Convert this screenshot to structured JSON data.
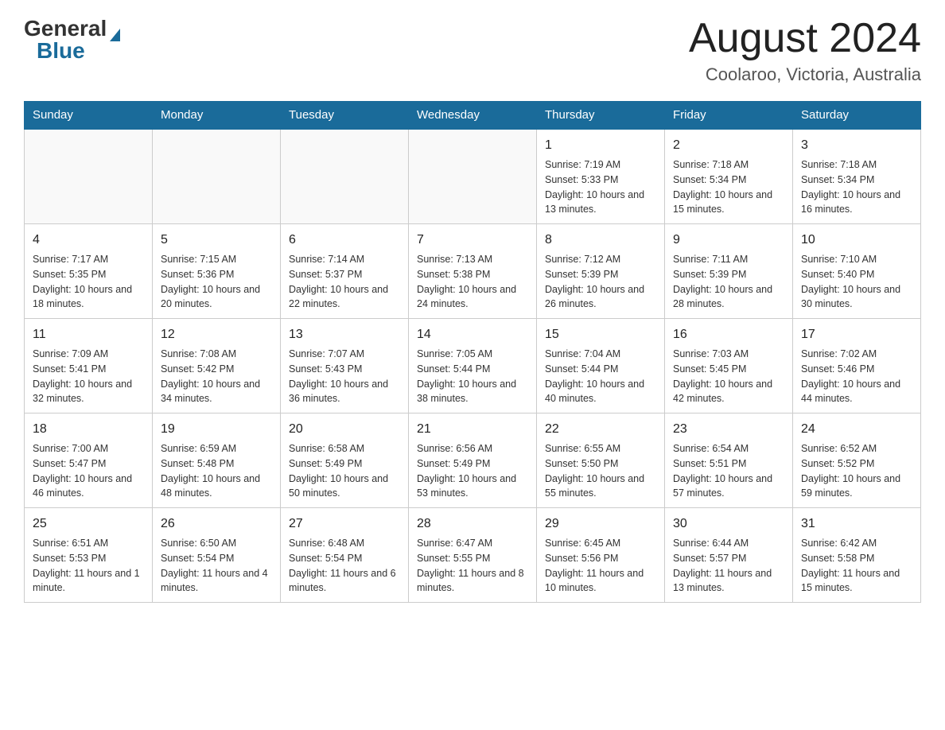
{
  "header": {
    "logo_general": "General",
    "logo_blue": "Blue",
    "title": "August 2024",
    "subtitle": "Coolaroo, Victoria, Australia"
  },
  "days_of_week": [
    "Sunday",
    "Monday",
    "Tuesday",
    "Wednesday",
    "Thursday",
    "Friday",
    "Saturday"
  ],
  "weeks": [
    [
      {
        "day": "",
        "sunrise": "",
        "sunset": "",
        "daylight": ""
      },
      {
        "day": "",
        "sunrise": "",
        "sunset": "",
        "daylight": ""
      },
      {
        "day": "",
        "sunrise": "",
        "sunset": "",
        "daylight": ""
      },
      {
        "day": "",
        "sunrise": "",
        "sunset": "",
        "daylight": ""
      },
      {
        "day": "1",
        "sunrise": "Sunrise: 7:19 AM",
        "sunset": "Sunset: 5:33 PM",
        "daylight": "Daylight: 10 hours and 13 minutes."
      },
      {
        "day": "2",
        "sunrise": "Sunrise: 7:18 AM",
        "sunset": "Sunset: 5:34 PM",
        "daylight": "Daylight: 10 hours and 15 minutes."
      },
      {
        "day": "3",
        "sunrise": "Sunrise: 7:18 AM",
        "sunset": "Sunset: 5:34 PM",
        "daylight": "Daylight: 10 hours and 16 minutes."
      }
    ],
    [
      {
        "day": "4",
        "sunrise": "Sunrise: 7:17 AM",
        "sunset": "Sunset: 5:35 PM",
        "daylight": "Daylight: 10 hours and 18 minutes."
      },
      {
        "day": "5",
        "sunrise": "Sunrise: 7:15 AM",
        "sunset": "Sunset: 5:36 PM",
        "daylight": "Daylight: 10 hours and 20 minutes."
      },
      {
        "day": "6",
        "sunrise": "Sunrise: 7:14 AM",
        "sunset": "Sunset: 5:37 PM",
        "daylight": "Daylight: 10 hours and 22 minutes."
      },
      {
        "day": "7",
        "sunrise": "Sunrise: 7:13 AM",
        "sunset": "Sunset: 5:38 PM",
        "daylight": "Daylight: 10 hours and 24 minutes."
      },
      {
        "day": "8",
        "sunrise": "Sunrise: 7:12 AM",
        "sunset": "Sunset: 5:39 PM",
        "daylight": "Daylight: 10 hours and 26 minutes."
      },
      {
        "day": "9",
        "sunrise": "Sunrise: 7:11 AM",
        "sunset": "Sunset: 5:39 PM",
        "daylight": "Daylight: 10 hours and 28 minutes."
      },
      {
        "day": "10",
        "sunrise": "Sunrise: 7:10 AM",
        "sunset": "Sunset: 5:40 PM",
        "daylight": "Daylight: 10 hours and 30 minutes."
      }
    ],
    [
      {
        "day": "11",
        "sunrise": "Sunrise: 7:09 AM",
        "sunset": "Sunset: 5:41 PM",
        "daylight": "Daylight: 10 hours and 32 minutes."
      },
      {
        "day": "12",
        "sunrise": "Sunrise: 7:08 AM",
        "sunset": "Sunset: 5:42 PM",
        "daylight": "Daylight: 10 hours and 34 minutes."
      },
      {
        "day": "13",
        "sunrise": "Sunrise: 7:07 AM",
        "sunset": "Sunset: 5:43 PM",
        "daylight": "Daylight: 10 hours and 36 minutes."
      },
      {
        "day": "14",
        "sunrise": "Sunrise: 7:05 AM",
        "sunset": "Sunset: 5:44 PM",
        "daylight": "Daylight: 10 hours and 38 minutes."
      },
      {
        "day": "15",
        "sunrise": "Sunrise: 7:04 AM",
        "sunset": "Sunset: 5:44 PM",
        "daylight": "Daylight: 10 hours and 40 minutes."
      },
      {
        "day": "16",
        "sunrise": "Sunrise: 7:03 AM",
        "sunset": "Sunset: 5:45 PM",
        "daylight": "Daylight: 10 hours and 42 minutes."
      },
      {
        "day": "17",
        "sunrise": "Sunrise: 7:02 AM",
        "sunset": "Sunset: 5:46 PM",
        "daylight": "Daylight: 10 hours and 44 minutes."
      }
    ],
    [
      {
        "day": "18",
        "sunrise": "Sunrise: 7:00 AM",
        "sunset": "Sunset: 5:47 PM",
        "daylight": "Daylight: 10 hours and 46 minutes."
      },
      {
        "day": "19",
        "sunrise": "Sunrise: 6:59 AM",
        "sunset": "Sunset: 5:48 PM",
        "daylight": "Daylight: 10 hours and 48 minutes."
      },
      {
        "day": "20",
        "sunrise": "Sunrise: 6:58 AM",
        "sunset": "Sunset: 5:49 PM",
        "daylight": "Daylight: 10 hours and 50 minutes."
      },
      {
        "day": "21",
        "sunrise": "Sunrise: 6:56 AM",
        "sunset": "Sunset: 5:49 PM",
        "daylight": "Daylight: 10 hours and 53 minutes."
      },
      {
        "day": "22",
        "sunrise": "Sunrise: 6:55 AM",
        "sunset": "Sunset: 5:50 PM",
        "daylight": "Daylight: 10 hours and 55 minutes."
      },
      {
        "day": "23",
        "sunrise": "Sunrise: 6:54 AM",
        "sunset": "Sunset: 5:51 PM",
        "daylight": "Daylight: 10 hours and 57 minutes."
      },
      {
        "day": "24",
        "sunrise": "Sunrise: 6:52 AM",
        "sunset": "Sunset: 5:52 PM",
        "daylight": "Daylight: 10 hours and 59 minutes."
      }
    ],
    [
      {
        "day": "25",
        "sunrise": "Sunrise: 6:51 AM",
        "sunset": "Sunset: 5:53 PM",
        "daylight": "Daylight: 11 hours and 1 minute."
      },
      {
        "day": "26",
        "sunrise": "Sunrise: 6:50 AM",
        "sunset": "Sunset: 5:54 PM",
        "daylight": "Daylight: 11 hours and 4 minutes."
      },
      {
        "day": "27",
        "sunrise": "Sunrise: 6:48 AM",
        "sunset": "Sunset: 5:54 PM",
        "daylight": "Daylight: 11 hours and 6 minutes."
      },
      {
        "day": "28",
        "sunrise": "Sunrise: 6:47 AM",
        "sunset": "Sunset: 5:55 PM",
        "daylight": "Daylight: 11 hours and 8 minutes."
      },
      {
        "day": "29",
        "sunrise": "Sunrise: 6:45 AM",
        "sunset": "Sunset: 5:56 PM",
        "daylight": "Daylight: 11 hours and 10 minutes."
      },
      {
        "day": "30",
        "sunrise": "Sunrise: 6:44 AM",
        "sunset": "Sunset: 5:57 PM",
        "daylight": "Daylight: 11 hours and 13 minutes."
      },
      {
        "day": "31",
        "sunrise": "Sunrise: 6:42 AM",
        "sunset": "Sunset: 5:58 PM",
        "daylight": "Daylight: 11 hours and 15 minutes."
      }
    ]
  ]
}
